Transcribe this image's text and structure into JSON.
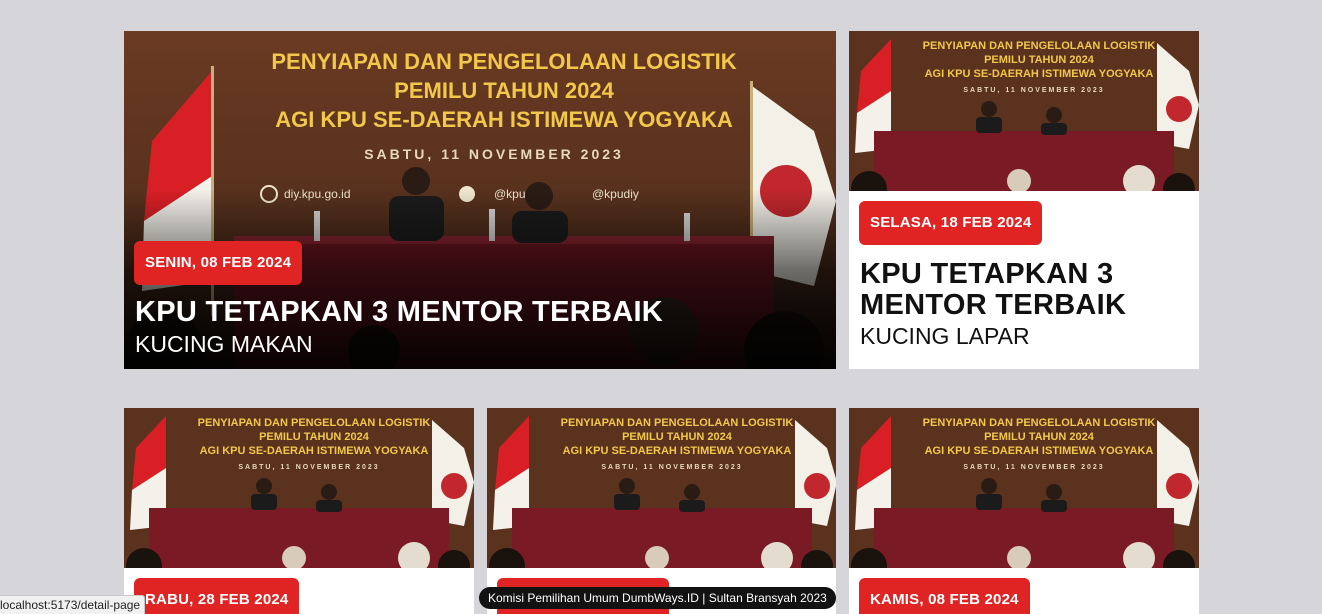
{
  "featured": {
    "date": "SENIN, 08 FEB 2024",
    "title": "KPU TETAPKAN 3 MENTOR TERBAIK",
    "subtitle": "KUCING MAKAN"
  },
  "side": {
    "date": "SELASA, 18 FEB 2024",
    "title": "KPU TETAPKAN 3 MENTOR TERBAIK",
    "subtitle": "KUCING LAPAR"
  },
  "cards": [
    {
      "date": "RABU, 28 FEB 2024"
    },
    {
      "date": ""
    },
    {
      "date": "KAMIS, 08 FEB 2024"
    }
  ],
  "photo": {
    "banner_line1": "PENYIAPAN DAN PENGELOLAAN LOGISTIK",
    "banner_line2": "PEMILU TAHUN 2024",
    "banner_line3": "AGI KPU SE-DAERAH ISTIMEWA YOGYAKA",
    "banner_date": "SABTU, 11 NOVEMBER 2023",
    "social_web": "diy.kpu.go.id",
    "social_tw": "@kpu",
    "social_ig": "@kpudiy"
  },
  "status_bar_url": "localhost:5173/detail-page",
  "footer": "Komisi Pemilihan Umum DumbWays.ID | Sultan Bransyah 2023",
  "colors": {
    "badge": "#e02424",
    "background": "#d6d5da"
  }
}
